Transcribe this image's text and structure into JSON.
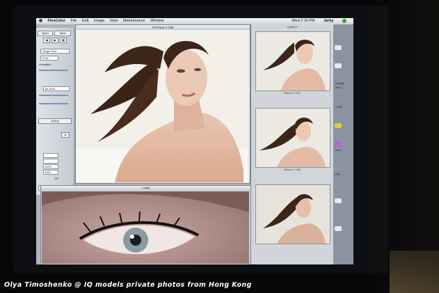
{
  "menubar": {
    "app": "FlexColor",
    "items": [
      "File",
      "Edit",
      "Image",
      "View",
      "Maintenance",
      "Window"
    ],
    "clock": "Wed 2:16 PM",
    "user": "Jarky"
  },
  "main_window": {
    "title": "# Picture C 046"
  },
  "thumbs": {
    "header": "Lightbox",
    "captions": [
      "Picture C 047",
      "Picture C 046",
      ""
    ]
  },
  "loupe": {
    "title": "Loupe"
  },
  "palette": {
    "open": "Open",
    "save": "Save",
    "gradation": "Gradation",
    "mode": "Single Shot",
    "color_mode": "RGB",
    "zoom": "1/8",
    "shot": "As Shot",
    "value1": "100%",
    "value2": "1000"
  },
  "desktop_labels": [
    "cycling",
    "ject 2",
    "1 HW",
    "hare",
    "pyg"
  ],
  "caption": "Olya Timoshenko @ IQ models private photos from Hong Kong",
  "colors": {
    "screen_bg": "#aeb4bc",
    "desk_bg": "#8c93a0",
    "caption": "#ffffff"
  }
}
